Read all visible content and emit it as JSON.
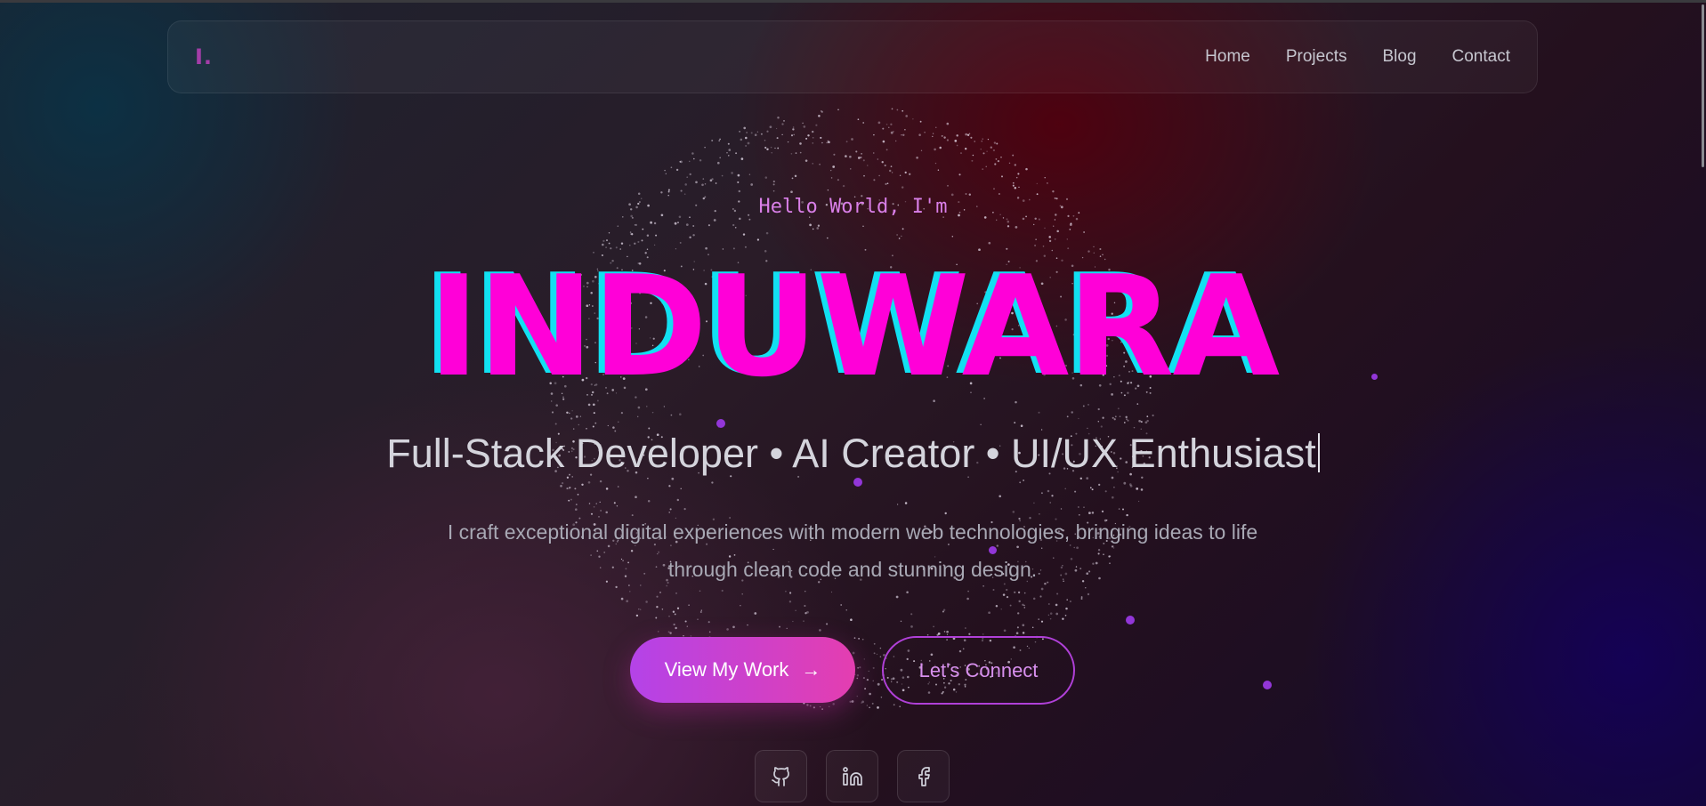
{
  "nav": {
    "logo": "I.",
    "links": [
      "Home",
      "Projects",
      "Blog",
      "Contact"
    ]
  },
  "hero": {
    "greeting": "Hello World, I'm",
    "name": "INDUWARA",
    "roles": "Full-Stack Developer • AI Creator • UI/UX Enthusiast",
    "description": "I craft exceptional digital experiences with modern web technologies, bringing ideas to life through clean code and stunning design."
  },
  "buttons": {
    "primary_label": "View My Work",
    "primary_arrow": "→",
    "secondary_label": "Let's Connect"
  },
  "social_icons": [
    "github-icon",
    "linkedin-icon",
    "facebook-icon"
  ],
  "colors": {
    "accent": "#ff00d8",
    "accent_shadow": "#12e0f2",
    "purple": "#b443e8",
    "pink": "#e43eb0"
  }
}
